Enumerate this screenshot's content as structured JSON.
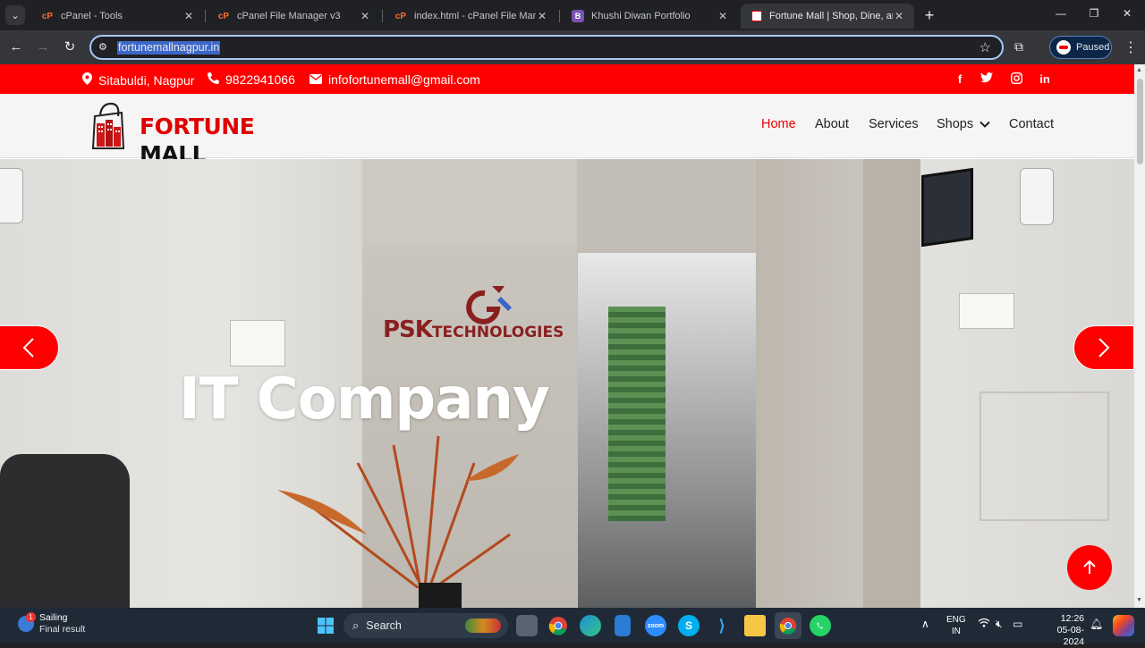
{
  "browser": {
    "tabs": [
      {
        "title": "cPanel - Tools",
        "icon": "cpanel-icon"
      },
      {
        "title": "cPanel File Manager v3",
        "icon": "cpanel-icon"
      },
      {
        "title": "index.html - cPanel File Manage",
        "icon": "cpanel-icon"
      },
      {
        "title": "Khushi Diwan Portfolio",
        "icon": "bootstrap-icon"
      },
      {
        "title": "Fortune Mall | Shop, Dine, and",
        "icon": "fortune-mall-icon",
        "active": true
      }
    ],
    "url": "fortunemallnagpur.in",
    "profile_status": "Paused"
  },
  "site": {
    "topbar": {
      "location": "Sitabuldi, Nagpur",
      "phone": "9822941066",
      "email": "infofortunemall@gmail.com",
      "social": [
        "facebook-icon",
        "twitter-icon",
        "instagram-icon",
        "linkedin-icon"
      ]
    },
    "logo": {
      "word1": "FORTUNE",
      "word2": "MALL"
    },
    "nav": {
      "home": "Home",
      "about": "About",
      "services": "Services",
      "shops": "Shops",
      "contact": "Contact"
    },
    "hero": {
      "caption": "IT Company",
      "sign_brand": "PSK",
      "sign_rest": "TECHNOLOGIES"
    }
  },
  "taskbar": {
    "weather": {
      "title": "Sailing",
      "subtitle": "Final result",
      "badge": "1"
    },
    "search_placeholder": "Search",
    "language": {
      "line1": "ENG",
      "line2": "IN"
    },
    "clock": {
      "time": "12:26",
      "date": "05-08-2024"
    }
  },
  "colors": {
    "brand_red": "#ff0000",
    "browser_dark": "#202124",
    "taskbar": "#1f2a36"
  }
}
